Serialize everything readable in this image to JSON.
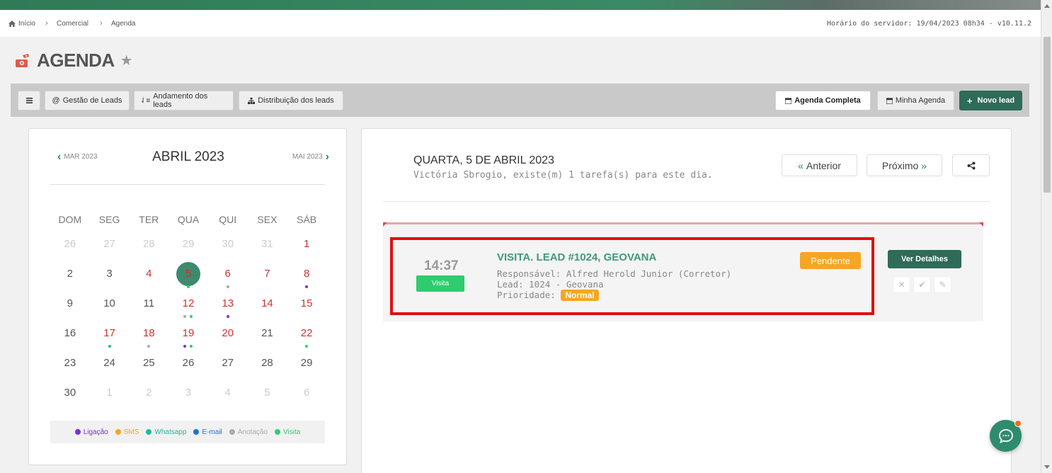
{
  "breadcrumb": {
    "items": [
      "Início",
      "Comercial",
      "Agenda"
    ],
    "server_time": "Horário do servidor: 19/04/2023 08h34 - v10.11.2"
  },
  "page": {
    "title": "AGENDA"
  },
  "toolbar": {
    "menu_icon": "hamburger-icon",
    "gestao": "Gestão de Leads",
    "andamento": "Andamento dos leads",
    "distribuicao": "Distribuição dos leads",
    "agenda_completa": "Agenda Completa",
    "minha_agenda": "Minha Agenda",
    "novo_lead": "Novo lead"
  },
  "calendar": {
    "month": "ABRIL 2023",
    "prev": "MAR 2023",
    "next": "MAI 2023",
    "weekdays": [
      "DOM",
      "SEG",
      "TER",
      "QUA",
      "QUI",
      "SEX",
      "SÁB"
    ],
    "days": [
      {
        "n": "26",
        "m": true
      },
      {
        "n": "27",
        "m": true
      },
      {
        "n": "28",
        "m": true
      },
      {
        "n": "29",
        "m": true
      },
      {
        "n": "30",
        "m": true
      },
      {
        "n": "31",
        "m": true
      },
      {
        "n": "1",
        "r": true
      },
      {
        "n": "2"
      },
      {
        "n": "3"
      },
      {
        "n": "4",
        "r": true
      },
      {
        "n": "5",
        "t": true,
        "d": [
          "#2ecc71"
        ]
      },
      {
        "n": "6",
        "r": true,
        "d": [
          "#aaaaaa"
        ]
      },
      {
        "n": "7",
        "r": true
      },
      {
        "n": "8",
        "r": true,
        "d": [
          "#7b2fd6"
        ]
      },
      {
        "n": "9"
      },
      {
        "n": "10"
      },
      {
        "n": "11"
      },
      {
        "n": "12",
        "r": true,
        "d": [
          "#aaaaaa",
          "#2ecc71"
        ]
      },
      {
        "n": "13",
        "r": true,
        "d": [
          "#7b2fd6"
        ]
      },
      {
        "n": "14",
        "r": true
      },
      {
        "n": "15",
        "r": true
      },
      {
        "n": "16"
      },
      {
        "n": "17",
        "r": true,
        "d": [
          "#1abc9c"
        ]
      },
      {
        "n": "18",
        "r": true,
        "d": [
          "#aaaaaa"
        ]
      },
      {
        "n": "19",
        "r": true,
        "d": [
          "#7b2fd6",
          "#2ecc71"
        ]
      },
      {
        "n": "20",
        "r": true
      },
      {
        "n": "21"
      },
      {
        "n": "22",
        "r": true,
        "d": [
          "#2ecc71"
        ]
      },
      {
        "n": "23"
      },
      {
        "n": "24"
      },
      {
        "n": "25"
      },
      {
        "n": "26"
      },
      {
        "n": "27"
      },
      {
        "n": "28"
      },
      {
        "n": "29"
      },
      {
        "n": "30"
      },
      {
        "n": "1",
        "m": true
      },
      {
        "n": "2",
        "m": true
      },
      {
        "n": "3",
        "m": true
      },
      {
        "n": "4",
        "m": true
      },
      {
        "n": "5",
        "m": true
      },
      {
        "n": "6",
        "m": true
      }
    ],
    "legend": [
      {
        "label": "Ligação",
        "color": "#7b2fd6"
      },
      {
        "label": "SMS",
        "color": "#f5a623"
      },
      {
        "label": "Whatsapp",
        "color": "#1abc9c"
      },
      {
        "label": "E-mail",
        "color": "#1e6fd9"
      },
      {
        "label": "Anotação",
        "color": "#aaaaaa"
      },
      {
        "label": "Visita",
        "color": "#2ecc71"
      }
    ]
  },
  "day_view": {
    "title": "QUARTA, 5 DE ABRIL 2023",
    "subtitle": "Victória Sbrogio, existe(m) 1 tarefa(s) para este dia.",
    "prev": "Anterior",
    "next": "Próximo",
    "share_icon": "share-icon"
  },
  "task": {
    "time": "14:37",
    "type": "Visita",
    "title": "VISITA. LEAD #1024, GEOVANA",
    "responsavel": "Responsável: Alfred Herold Junior (Corretor)",
    "lead": "Lead: 1024 - Geovana",
    "prioridade_label": "Prioridade:",
    "prioridade": "Normal",
    "status": "Pendente",
    "details": "Ver Detalhes"
  },
  "colors": {
    "brand_green": "#2e6b58",
    "accent_green": "#3e9a78",
    "warning": "#f5a623",
    "highlight_red": "#e01010"
  }
}
